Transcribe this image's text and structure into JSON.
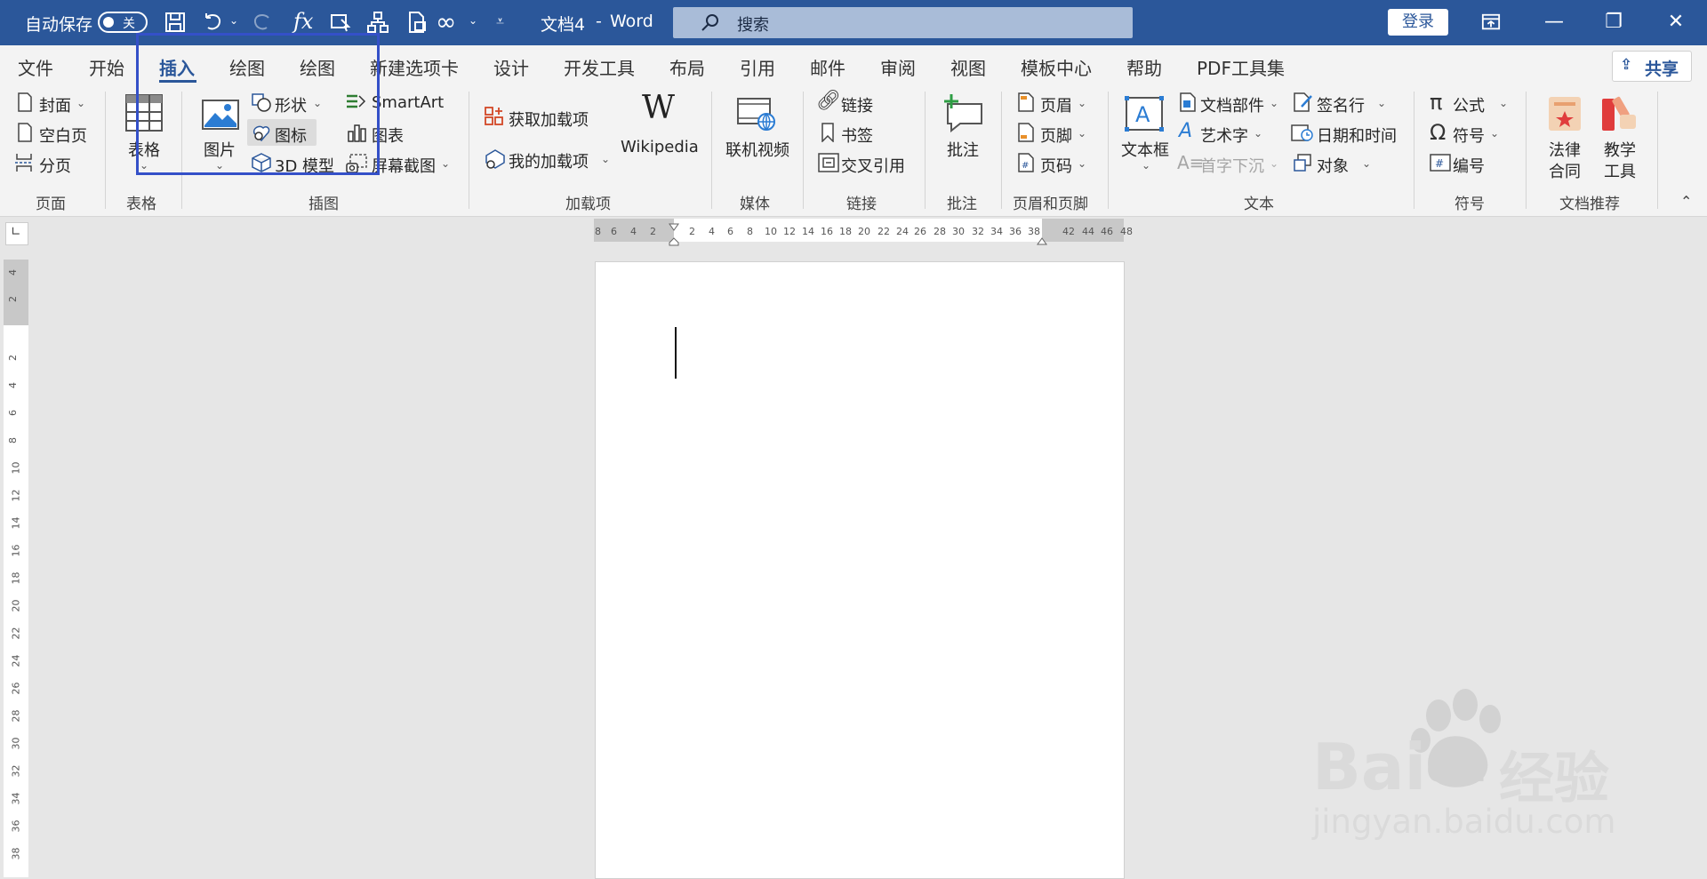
{
  "titlebar": {
    "autosave_label": "自动保存",
    "autosave_state": "关",
    "doc_title": "文档4",
    "separator": "-",
    "app_name": "Word",
    "search_placeholder": "搜索",
    "login_label": "登录",
    "quick_access_icons": [
      "save-icon",
      "undo-icon",
      "redo-icon",
      "function-icon",
      "touch-mode-icon",
      "org-chart-icon",
      "document-icon",
      "infinity-icon",
      "customize-icon"
    ]
  },
  "tabs": [
    "文件",
    "开始",
    "插入",
    "绘图",
    "绘图",
    "新建选项卡",
    "设计",
    "开发工具",
    "布局",
    "引用",
    "邮件",
    "审阅",
    "视图",
    "模板中心",
    "帮助",
    "PDF工具集"
  ],
  "active_tab": "插入",
  "share_label": "共享",
  "ribbon": {
    "page": {
      "cover": "封面",
      "blank": "空白页",
      "break": "分页",
      "group": "页面"
    },
    "table": {
      "table": "表格",
      "group": "表格"
    },
    "illustrations": {
      "picture": "图片",
      "shapes": "形状",
      "icons": "图标",
      "model3d": "3D 模型",
      "smartart": "SmartArt",
      "chart": "图表",
      "screenshot": "屏幕截图",
      "group": "插图"
    },
    "addins": {
      "get": "获取加载项",
      "my": "我的加载项",
      "wikipedia": "Wikipedia",
      "group": "加载项"
    },
    "media": {
      "video": "联机视频",
      "group": "媒体"
    },
    "links": {
      "link": "链接",
      "bookmark": "书签",
      "crossref": "交叉引用",
      "group": "链接"
    },
    "comments": {
      "comment": "批注",
      "group": "批注"
    },
    "headerfooter": {
      "header": "页眉",
      "footer": "页脚",
      "pagenum": "页码",
      "group": "页眉和页脚"
    },
    "text": {
      "textbox": "文本框",
      "quickparts": "文档部件",
      "wordart": "艺术字",
      "dropcap": "首字下沉",
      "signature": "签名行",
      "datetime": "日期和时间",
      "object": "对象",
      "group": "文本"
    },
    "symbols": {
      "equation": "公式",
      "symbol": "符号",
      "number": "编号",
      "group": "符号"
    },
    "recommend": {
      "legal1": "法律",
      "legal2": "合同",
      "teach1": "教学",
      "teach2": "工具",
      "group": "文档推荐"
    }
  },
  "hruler": [
    "8",
    "6",
    "4",
    "2",
    "2",
    "4",
    "6",
    "8",
    "10",
    "12",
    "14",
    "16",
    "18",
    "20",
    "22",
    "24",
    "26",
    "28",
    "30",
    "32",
    "34",
    "36",
    "38",
    "42",
    "44",
    "46",
    "48"
  ],
  "vruler": [
    "4",
    "2",
    "2",
    "4",
    "6",
    "8",
    "10",
    "12",
    "14",
    "16",
    "18",
    "20",
    "22",
    "24",
    "26",
    "28",
    "30",
    "32",
    "34",
    "36",
    "38"
  ],
  "watermark": {
    "brand": "Bai",
    "brand2": "du",
    "cn": "经验",
    "url": "jingyan.baidu.com"
  }
}
